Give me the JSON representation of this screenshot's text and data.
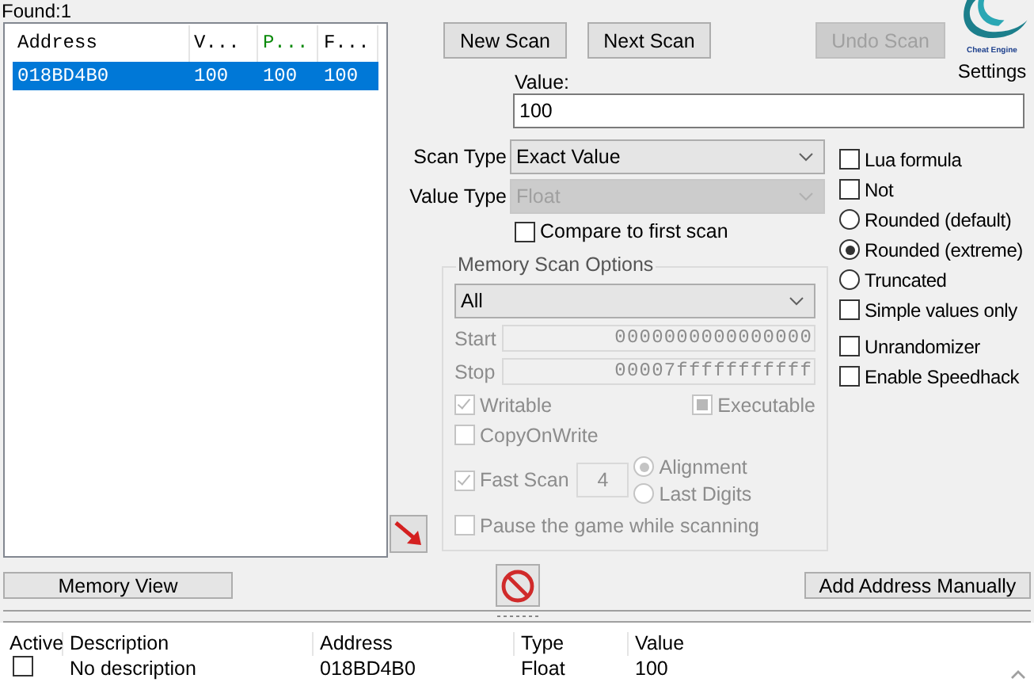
{
  "found": "Found:1",
  "results": {
    "columns": [
      {
        "label": "Address",
        "color": "#000000"
      },
      {
        "label": "V...",
        "color": "#000000"
      },
      {
        "label": "P...",
        "color": "#0a8a0a"
      },
      {
        "label": "F...",
        "color": "#000000"
      }
    ],
    "rows": [
      {
        "cells": [
          "018BD4B0",
          "100",
          "100",
          "100"
        ],
        "selected": true
      }
    ]
  },
  "scan_buttons": [
    {
      "label": "New Scan",
      "disabled": false
    },
    {
      "label": "Next Scan",
      "disabled": false
    },
    {
      "label": "Undo Scan",
      "disabled": true
    }
  ],
  "logo": {
    "text": "Cheat Engine",
    "caption": "Settings"
  },
  "value": {
    "label": "Value:",
    "value": "100"
  },
  "scan_type": {
    "label": "Scan Type",
    "value": "Exact Value",
    "disabled": false
  },
  "value_type": {
    "label": "Value Type",
    "value": "Float",
    "disabled": true
  },
  "compare_first": {
    "label": "Compare to first scan",
    "checked": false
  },
  "options": [
    {
      "kind": "checkbox",
      "label": "Lua formula",
      "checked": false
    },
    {
      "kind": "checkbox",
      "label": "Not",
      "checked": false
    },
    {
      "kind": "radio",
      "label": "Rounded (default)",
      "selected": false
    },
    {
      "kind": "radio",
      "label": "Rounded (extreme)",
      "selected": true
    },
    {
      "kind": "radio",
      "label": "Truncated",
      "selected": false
    },
    {
      "kind": "checkbox",
      "label": "Simple values only",
      "checked": false
    }
  ],
  "extras": [
    {
      "label": "Unrandomizer",
      "checked": false
    },
    {
      "label": "Enable Speedhack",
      "checked": false
    }
  ],
  "memory_scan_options": {
    "title": "Memory Scan Options",
    "disabled": true,
    "region": "All",
    "start_label": "Start",
    "start": "0000000000000000",
    "stop_label": "Stop",
    "stop": "00007fffffffffff",
    "writable": {
      "label": "Writable",
      "checked": true
    },
    "executable": {
      "label": "Executable",
      "indeterminate": true
    },
    "copy_on_write": {
      "label": "CopyOnWrite",
      "checked": false
    },
    "fast_scan": {
      "label": "Fast Scan",
      "checked": true,
      "value": "4"
    },
    "alignment": [
      {
        "label": "Alignment",
        "selected": true
      },
      {
        "label": "Last Digits",
        "selected": false
      }
    ],
    "pause": {
      "label": "Pause the game while scanning",
      "checked": false
    }
  },
  "memory_view": "Memory View",
  "add_address": "Add Address Manually",
  "cheat_table": {
    "columns": [
      "Active",
      "Description",
      "Address",
      "Type",
      "Value"
    ],
    "rows": [
      {
        "active": false,
        "description": "No description",
        "address": "018BD4B0",
        "type": "Float",
        "value": "100"
      }
    ]
  }
}
